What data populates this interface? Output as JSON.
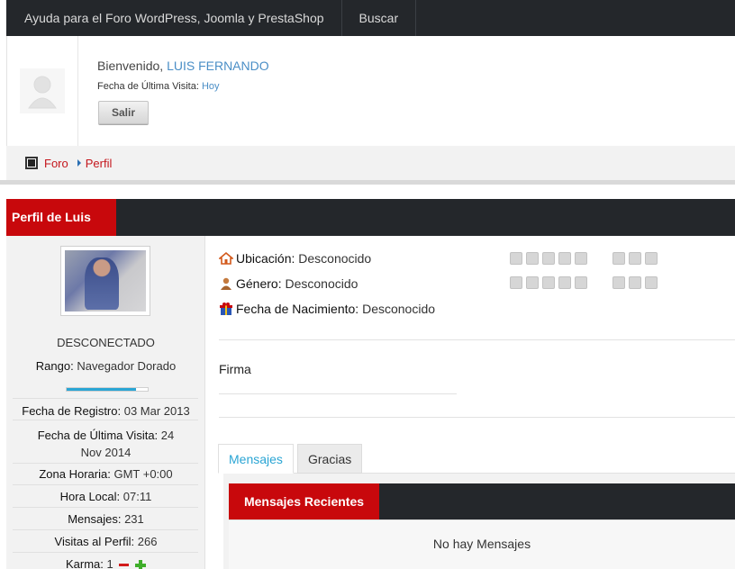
{
  "nav": {
    "items": [
      "Ayuda para el Foro WordPress, Joomla y PrestaShop",
      "Buscar"
    ]
  },
  "user": {
    "welcome_label": "Bienvenido,",
    "username": "LUIS FERNANDO",
    "last_visit_label": "Fecha de Última Visita:",
    "last_visit_value": "Hoy",
    "logout_label": "Salir"
  },
  "breadcrumb": [
    "Foro",
    "Perfil"
  ],
  "profile": {
    "header_title": "Perfil de Luis",
    "status": "DESCONECTADO",
    "rank_label": "Rango:",
    "rank_value": "Navegador Dorado",
    "rank_progress": 0.85,
    "registered_label": "Fecha de Registro:",
    "registered_value": "03 Mar 2013",
    "last_visit_label": "Fecha de Última Visita:",
    "last_visit_value": "24 Nov 2014",
    "timezone_label": "Zona Horaria:",
    "timezone_value": "GMT +0:00",
    "localtime_label": "Hora Local:",
    "localtime_value": "07:11",
    "posts_label": "Mensajes:",
    "posts_value": "231",
    "views_label": "Visitas al Perfil:",
    "views_value": "266",
    "karma_label": "Karma:",
    "karma_value": "1"
  },
  "details": {
    "location_label": "Ubicación:",
    "location_value": "Desconocido",
    "gender_label": "Género:",
    "gender_value": "Desconocido",
    "birthdate_label": "Fecha de Nacimiento:",
    "birthdate_value": "Desconocido",
    "signature_label": "Firma"
  },
  "tabs": [
    "Mensajes",
    "Gracias"
  ],
  "recent": {
    "title": "Mensajes Recientes",
    "empty": "No hay Mensajes"
  },
  "colors": {
    "accent_red": "#c8080c",
    "link_blue": "#4a8ec6",
    "tab_blue": "#2aa5d4",
    "dark": "#24272b"
  }
}
